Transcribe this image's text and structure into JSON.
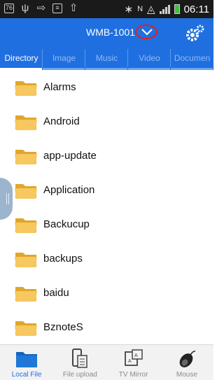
{
  "status_bar": {
    "time": "06:11"
  },
  "header": {
    "device_name": "WMB-1001"
  },
  "tabs": [
    "Directory",
    "Image",
    "Music",
    "Video",
    "Documen"
  ],
  "folders": [
    "Alarms",
    "Android",
    "app-update",
    "Application",
    "Backucup",
    "backups",
    "baidu",
    "BznoteS"
  ],
  "bottom_nav": [
    "Local File",
    "File upload",
    "TV Mirror",
    "Mouse"
  ],
  "colors": {
    "accent": "#1f6fe0",
    "status_bar": "#1a1a1a",
    "dropdown_highlight": "#e02020"
  }
}
